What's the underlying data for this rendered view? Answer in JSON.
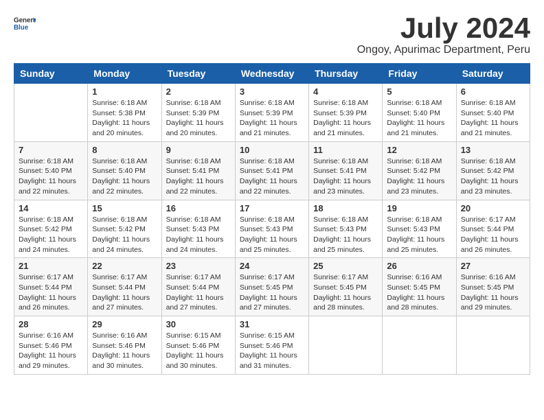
{
  "logo": {
    "text1": "General",
    "text2": "Blue"
  },
  "header": {
    "title": "July 2024",
    "subtitle": "Ongoy, Apurimac Department, Peru"
  },
  "days_of_week": [
    "Sunday",
    "Monday",
    "Tuesday",
    "Wednesday",
    "Thursday",
    "Friday",
    "Saturday"
  ],
  "weeks": [
    [
      {
        "day": "",
        "info": ""
      },
      {
        "day": "1",
        "info": "Sunrise: 6:18 AM\nSunset: 5:38 PM\nDaylight: 11 hours\nand 20 minutes."
      },
      {
        "day": "2",
        "info": "Sunrise: 6:18 AM\nSunset: 5:39 PM\nDaylight: 11 hours\nand 20 minutes."
      },
      {
        "day": "3",
        "info": "Sunrise: 6:18 AM\nSunset: 5:39 PM\nDaylight: 11 hours\nand 21 minutes."
      },
      {
        "day": "4",
        "info": "Sunrise: 6:18 AM\nSunset: 5:39 PM\nDaylight: 11 hours\nand 21 minutes."
      },
      {
        "day": "5",
        "info": "Sunrise: 6:18 AM\nSunset: 5:40 PM\nDaylight: 11 hours\nand 21 minutes."
      },
      {
        "day": "6",
        "info": "Sunrise: 6:18 AM\nSunset: 5:40 PM\nDaylight: 11 hours\nand 21 minutes."
      }
    ],
    [
      {
        "day": "7",
        "info": "Sunrise: 6:18 AM\nSunset: 5:40 PM\nDaylight: 11 hours\nand 22 minutes."
      },
      {
        "day": "8",
        "info": "Sunrise: 6:18 AM\nSunset: 5:40 PM\nDaylight: 11 hours\nand 22 minutes."
      },
      {
        "day": "9",
        "info": "Sunrise: 6:18 AM\nSunset: 5:41 PM\nDaylight: 11 hours\nand 22 minutes."
      },
      {
        "day": "10",
        "info": "Sunrise: 6:18 AM\nSunset: 5:41 PM\nDaylight: 11 hours\nand 22 minutes."
      },
      {
        "day": "11",
        "info": "Sunrise: 6:18 AM\nSunset: 5:41 PM\nDaylight: 11 hours\nand 23 minutes."
      },
      {
        "day": "12",
        "info": "Sunrise: 6:18 AM\nSunset: 5:42 PM\nDaylight: 11 hours\nand 23 minutes."
      },
      {
        "day": "13",
        "info": "Sunrise: 6:18 AM\nSunset: 5:42 PM\nDaylight: 11 hours\nand 23 minutes."
      }
    ],
    [
      {
        "day": "14",
        "info": "Sunrise: 6:18 AM\nSunset: 5:42 PM\nDaylight: 11 hours\nand 24 minutes."
      },
      {
        "day": "15",
        "info": "Sunrise: 6:18 AM\nSunset: 5:42 PM\nDaylight: 11 hours\nand 24 minutes."
      },
      {
        "day": "16",
        "info": "Sunrise: 6:18 AM\nSunset: 5:43 PM\nDaylight: 11 hours\nand 24 minutes."
      },
      {
        "day": "17",
        "info": "Sunrise: 6:18 AM\nSunset: 5:43 PM\nDaylight: 11 hours\nand 25 minutes."
      },
      {
        "day": "18",
        "info": "Sunrise: 6:18 AM\nSunset: 5:43 PM\nDaylight: 11 hours\nand 25 minutes."
      },
      {
        "day": "19",
        "info": "Sunrise: 6:18 AM\nSunset: 5:43 PM\nDaylight: 11 hours\nand 25 minutes."
      },
      {
        "day": "20",
        "info": "Sunrise: 6:17 AM\nSunset: 5:44 PM\nDaylight: 11 hours\nand 26 minutes."
      }
    ],
    [
      {
        "day": "21",
        "info": "Sunrise: 6:17 AM\nSunset: 5:44 PM\nDaylight: 11 hours\nand 26 minutes."
      },
      {
        "day": "22",
        "info": "Sunrise: 6:17 AM\nSunset: 5:44 PM\nDaylight: 11 hours\nand 27 minutes."
      },
      {
        "day": "23",
        "info": "Sunrise: 6:17 AM\nSunset: 5:44 PM\nDaylight: 11 hours\nand 27 minutes."
      },
      {
        "day": "24",
        "info": "Sunrise: 6:17 AM\nSunset: 5:45 PM\nDaylight: 11 hours\nand 27 minutes."
      },
      {
        "day": "25",
        "info": "Sunrise: 6:17 AM\nSunset: 5:45 PM\nDaylight: 11 hours\nand 28 minutes."
      },
      {
        "day": "26",
        "info": "Sunrise: 6:16 AM\nSunset: 5:45 PM\nDaylight: 11 hours\nand 28 minutes."
      },
      {
        "day": "27",
        "info": "Sunrise: 6:16 AM\nSunset: 5:45 PM\nDaylight: 11 hours\nand 29 minutes."
      }
    ],
    [
      {
        "day": "28",
        "info": "Sunrise: 6:16 AM\nSunset: 5:46 PM\nDaylight: 11 hours\nand 29 minutes."
      },
      {
        "day": "29",
        "info": "Sunrise: 6:16 AM\nSunset: 5:46 PM\nDaylight: 11 hours\nand 30 minutes."
      },
      {
        "day": "30",
        "info": "Sunrise: 6:15 AM\nSunset: 5:46 PM\nDaylight: 11 hours\nand 30 minutes."
      },
      {
        "day": "31",
        "info": "Sunrise: 6:15 AM\nSunset: 5:46 PM\nDaylight: 11 hours\nand 31 minutes."
      },
      {
        "day": "",
        "info": ""
      },
      {
        "day": "",
        "info": ""
      },
      {
        "day": "",
        "info": ""
      }
    ]
  ]
}
